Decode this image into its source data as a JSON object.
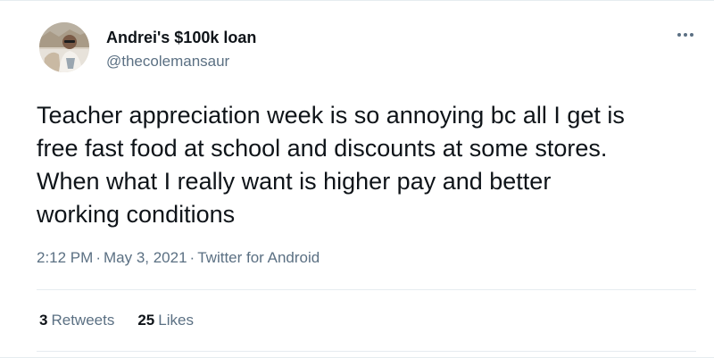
{
  "author": {
    "display_name": "Andrei's $100k loan",
    "handle": "@thecolemansaur"
  },
  "tweet": {
    "text": "Teacher appreciation week is so annoying bc all I get is\nfree fast food at school and discounts at some stores.\nWhen what I really want is higher pay and better\nworking conditions",
    "time": "2:12 PM",
    "date": "May 3, 2021",
    "source": "Twitter for Android",
    "separator": "·"
  },
  "stats": {
    "retweets_count": "3",
    "retweets_label": "Retweets",
    "likes_count": "25",
    "likes_label": "Likes"
  },
  "icons": {
    "more": "more-horizontal-icon"
  },
  "colors": {
    "text_primary": "#0f1419",
    "text_secondary": "#5b7083",
    "divider": "#e6ecf0"
  }
}
